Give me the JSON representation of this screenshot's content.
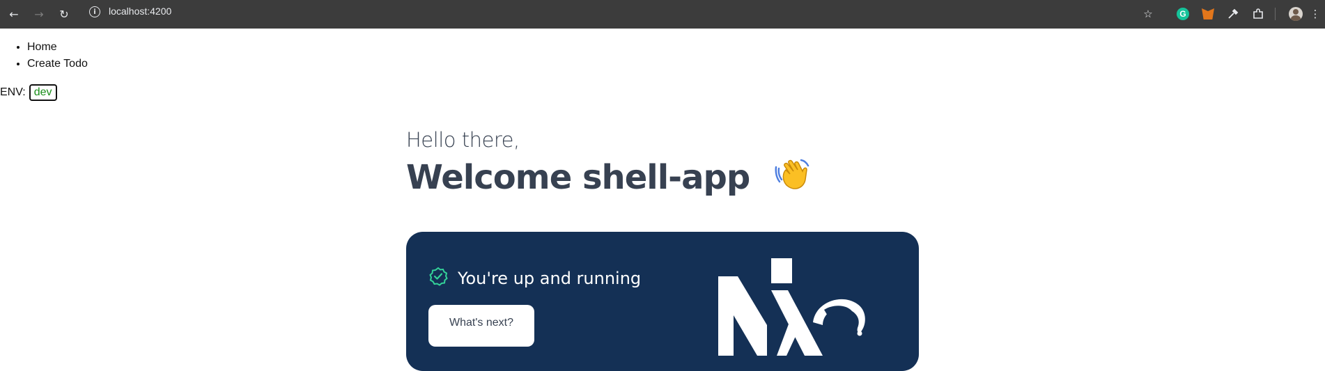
{
  "browser": {
    "url": "localhost:4200",
    "icons": [
      "back-icon",
      "forward-icon",
      "reload-icon",
      "info-icon",
      "star-icon",
      "grammarly-icon",
      "metamask-icon",
      "eyedropper-icon",
      "extensions-icon",
      "profile-avatar",
      "more-icon"
    ],
    "colors": {
      "chrome_bg": "#3c3c3c",
      "chrome_text": "#e8eaed"
    }
  },
  "nav": {
    "items": [
      {
        "label": "Home"
      },
      {
        "label": "Create Todo"
      }
    ]
  },
  "env": {
    "label": "ENV:",
    "value": "dev",
    "value_color": "#1a8f1a"
  },
  "welcome": {
    "greeting": "Hello there,",
    "title": "Welcome shell-app",
    "emoji_icon": "waving-hand-icon"
  },
  "hero": {
    "status_text": "You're up and running",
    "button_label": "What's next?",
    "background": "#143055",
    "check_color": "#34d399",
    "logo": "nx-logo"
  }
}
